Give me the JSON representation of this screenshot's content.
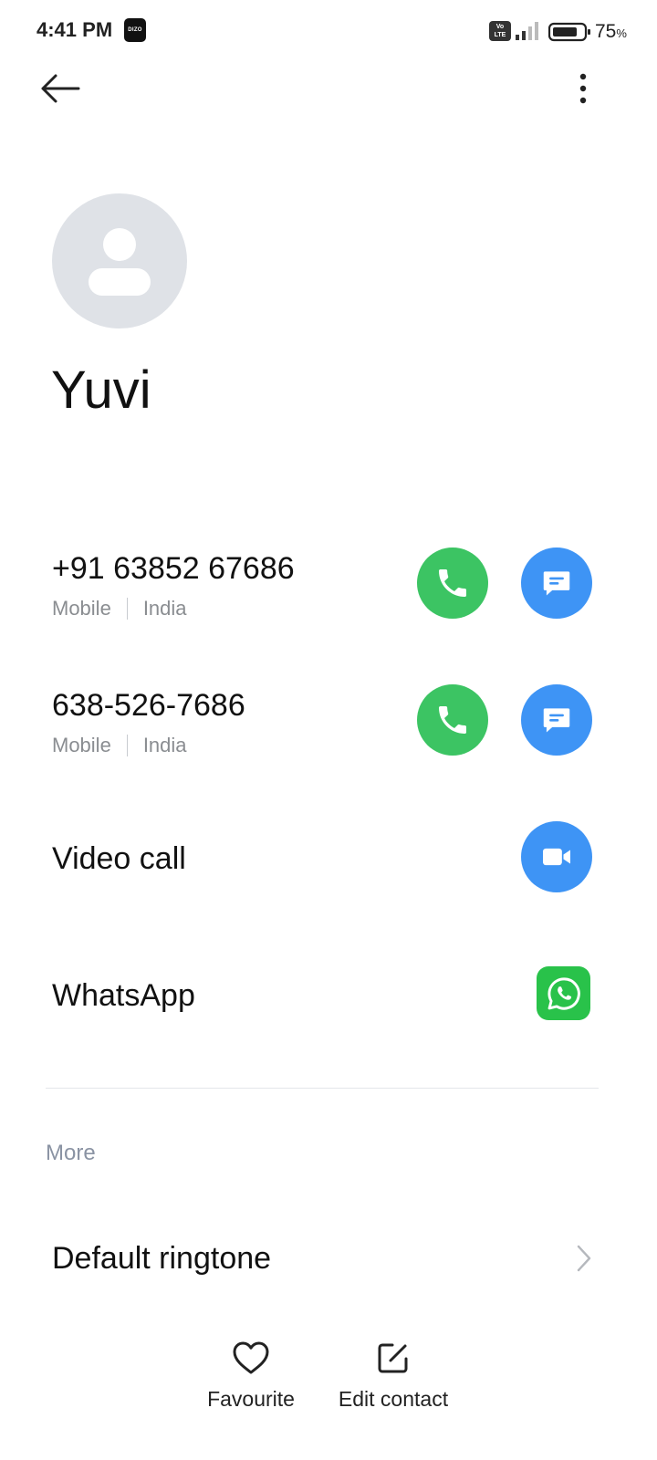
{
  "status_bar": {
    "time": "4:41 PM",
    "notification_badge": "DIZO",
    "network_badge_top": "Vo",
    "network_badge_bottom": "LTE",
    "battery_level": "75",
    "battery_unit": "%"
  },
  "toolbar": {
    "back_icon": "arrow-left-icon",
    "more_icon": "more-vertical-icon"
  },
  "contact": {
    "avatar_icon": "person-placeholder-icon",
    "name": "Yuvi"
  },
  "phones": [
    {
      "number": "+91 63852 67686",
      "type": "Mobile",
      "region": "India"
    },
    {
      "number": "638-526-7686",
      "type": "Mobile",
      "region": "India"
    }
  ],
  "video_call": {
    "label": "Video call",
    "icon": "video-camera-icon"
  },
  "whatsapp": {
    "label": "WhatsApp",
    "icon": "whatsapp-icon"
  },
  "more_section": {
    "header": "More",
    "items": [
      {
        "label": "Default ringtone",
        "icon": "chevron-right-icon"
      }
    ]
  },
  "bottom_actions": [
    {
      "label": "Favourite",
      "icon": "heart-icon"
    },
    {
      "label": "Edit contact",
      "icon": "edit-icon"
    }
  ],
  "colors": {
    "call_green": "#3cc463",
    "message_blue": "#3e94f5",
    "whatsapp_green": "#29c24a",
    "avatar_gray": "#dfe2e7"
  }
}
